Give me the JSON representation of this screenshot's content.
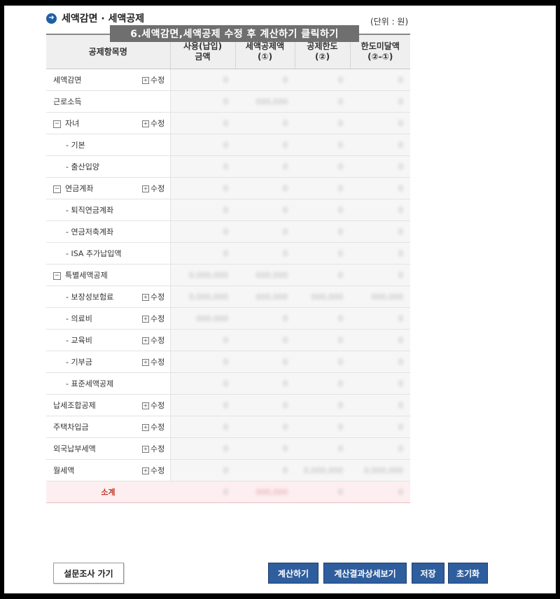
{
  "header": {
    "title": "세액감면 · 세액공제",
    "unit": "(단위 : 원)"
  },
  "banner": "6.세액감면,세액공제 수정 후 계산하기 클릭하기",
  "table": {
    "columns": [
      "공제항목명",
      "사용(납입)\n금액",
      "세액공제액\n(①)",
      "공제한도\n(②)",
      "한도미달액\n(②-①)"
    ],
    "modify_label": "수정",
    "rows": [
      {
        "label": "세액감면",
        "level": 0,
        "collapsible": false,
        "modify": true,
        "values": [
          "0",
          "0",
          "0",
          "0"
        ]
      },
      {
        "label": "근로소득",
        "level": 0,
        "collapsible": false,
        "modify": false,
        "values": [
          "0",
          "000,000",
          "0",
          "0"
        ]
      },
      {
        "label": "자녀",
        "level": 0,
        "collapsible": true,
        "modify": true,
        "values": [
          "0",
          "0",
          "0",
          "0"
        ]
      },
      {
        "label": "- 기본",
        "level": 1,
        "collapsible": false,
        "modify": false,
        "values": [
          "0",
          "0",
          "0",
          "0"
        ]
      },
      {
        "label": "- 출산입양",
        "level": 1,
        "collapsible": false,
        "modify": false,
        "values": [
          "0",
          "0",
          "0",
          "0"
        ]
      },
      {
        "label": "연금계좌",
        "level": 0,
        "collapsible": true,
        "modify": true,
        "values": [
          "0",
          "0",
          "0",
          "0"
        ]
      },
      {
        "label": "- 퇴직연금계좌",
        "level": 1,
        "collapsible": false,
        "modify": false,
        "values": [
          "0",
          "0",
          "0",
          "0"
        ]
      },
      {
        "label": "- 연금저축계좌",
        "level": 1,
        "collapsible": false,
        "modify": false,
        "values": [
          "0",
          "0",
          "0",
          "0"
        ]
      },
      {
        "label": "- ISA 추가납입액",
        "level": 1,
        "collapsible": false,
        "modify": false,
        "values": [
          "0",
          "0",
          "0",
          "0"
        ]
      },
      {
        "label": "특별세액공제",
        "level": 0,
        "collapsible": true,
        "modify": false,
        "values": [
          "0,000,000",
          "000,000",
          "0",
          "0"
        ]
      },
      {
        "label": "- 보장성보험료",
        "level": 1,
        "collapsible": false,
        "modify": true,
        "values": [
          "0,000,000",
          "000,000",
          "000,000",
          "000,000"
        ]
      },
      {
        "label": "- 의료비",
        "level": 1,
        "collapsible": false,
        "modify": true,
        "values": [
          "000,000",
          "0",
          "0",
          "0"
        ]
      },
      {
        "label": "- 교육비",
        "level": 1,
        "collapsible": false,
        "modify": true,
        "values": [
          "0",
          "0",
          "0",
          "0"
        ]
      },
      {
        "label": "- 기부금",
        "level": 1,
        "collapsible": false,
        "modify": true,
        "values": [
          "0",
          "0",
          "0",
          "0"
        ]
      },
      {
        "label": "- 표준세액공제",
        "level": 1,
        "collapsible": false,
        "modify": false,
        "values": [
          "0",
          "0",
          "0",
          "0"
        ]
      },
      {
        "label": "납세조합공제",
        "level": 0,
        "collapsible": false,
        "modify": true,
        "values": [
          "0",
          "0",
          "0",
          "0"
        ]
      },
      {
        "label": "주택차입금",
        "level": 0,
        "collapsible": false,
        "modify": true,
        "values": [
          "0",
          "0",
          "0",
          "0"
        ]
      },
      {
        "label": "외국납부세액",
        "level": 0,
        "collapsible": false,
        "modify": true,
        "values": [
          "0",
          "0",
          "0",
          "0"
        ]
      },
      {
        "label": "월세액",
        "level": 0,
        "collapsible": false,
        "modify": true,
        "values": [
          "0",
          "0",
          "0,000,000",
          "0,000,000"
        ]
      }
    ],
    "total": {
      "label": "소계",
      "values": [
        "0",
        "000,000",
        "0",
        "0"
      ]
    }
  },
  "buttons": {
    "survey": "설문조사 가기",
    "calculate": "계산하기",
    "detail": "계산결과상세보기",
    "save": "저장",
    "reset": "초기화"
  },
  "colors": {
    "button_blue": "#2f5e9e",
    "banner": "#6f6f6f",
    "total_bg": "#fdeef0",
    "total_text": "#c0392b"
  },
  "icons": {
    "title_bullet": "arrow-circle-icon",
    "collapse": "minus-box-icon",
    "modify": "plus-box-icon"
  }
}
